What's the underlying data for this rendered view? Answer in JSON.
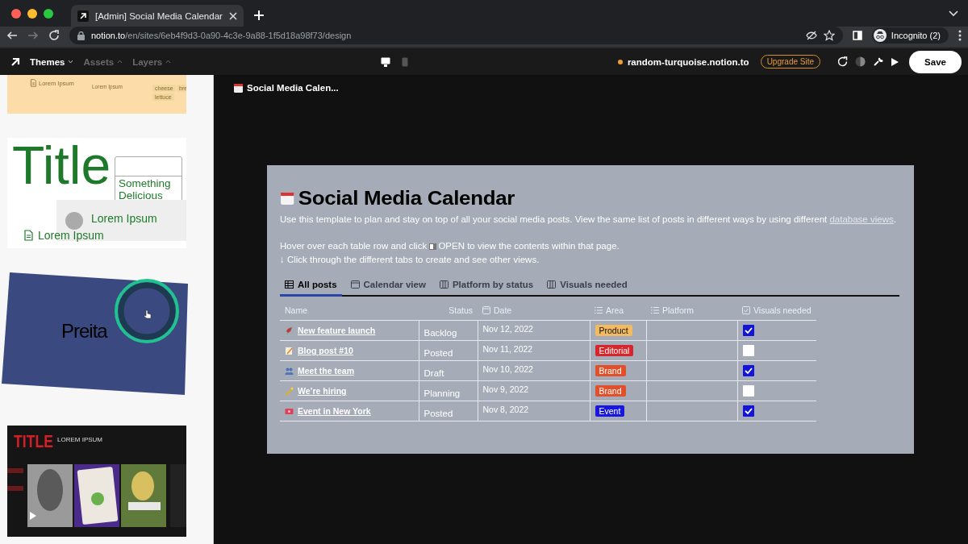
{
  "browser": {
    "tab_title": "[Admin] Social Media Calendar",
    "url_host": "notion.to",
    "url_path": "/en/sites/6eb4f9d3-0a90-4c3e-9a88-1f5d18a98f73/design",
    "profile_label": "Incognito (2)"
  },
  "toolbar": {
    "menus": [
      {
        "label": "Themes",
        "selected": true
      },
      {
        "label": "Assets",
        "selected": false
      },
      {
        "label": "Layers",
        "selected": false
      }
    ],
    "site_name": "random-turquoise.notion.to",
    "upgrade_button": "Upgrade Site",
    "save_button": "Save"
  },
  "sidebar": {
    "thumbnails": [
      {
        "kind": "table",
        "texts": [
          "Lorem Ipsum",
          "Lorem Ipsum"
        ],
        "tags": [
          "cheese",
          "bre",
          "lettuce"
        ]
      },
      {
        "kind": "title",
        "title": "Title",
        "box_text": "Something Delicious",
        "texts": [
          "Lorem Ipsum",
          "Lorem Ipsum"
        ]
      },
      {
        "kind": "dark",
        "texts": [
          "Preita"
        ]
      },
      {
        "kind": "posters",
        "title": "TITLE",
        "subtitle": "LOREM IPSUM"
      }
    ]
  },
  "page": {
    "breadcrumb": "Social Media Calen...",
    "title": "Social Media Calendar",
    "description": "Use this template to plan and stay on top of all your social media posts. View the same list of posts in different ways by using different ",
    "description_link": "database views",
    "description_end": ".",
    "instructions": [
      "Hover over each table row and click",
      "OPEN to view the contents within that page.",
      "↓ Click through the different tabs to create and see other views."
    ],
    "tabs": [
      {
        "label": "All posts",
        "selected": true
      },
      {
        "label": "Calendar view",
        "selected": false
      },
      {
        "label": "Platform by status",
        "selected": false
      },
      {
        "label": "Visuals needed",
        "selected": false
      }
    ],
    "columns": [
      "Name",
      "Status",
      "Date",
      "Area",
      "Platform",
      "Visuals needed"
    ],
    "rows": [
      {
        "name": "New feature launch",
        "status": "Backlog",
        "date": "Nov 12, 2022",
        "area": "Product",
        "color": "#f2bb62",
        "visuals_needed": true
      },
      {
        "name": "Blog post #10",
        "status": "Posted",
        "date": "Nov 11, 2022",
        "area": "Editorial",
        "color": "#d7262b",
        "visuals_needed": false
      },
      {
        "name": "Meet the team",
        "status": "Draft",
        "date": "Nov 10, 2022",
        "area": "Brand",
        "color": "#e0502a",
        "visuals_needed": true
      },
      {
        "name": "We’re hiring",
        "status": "Planning",
        "date": "Nov 9, 2022",
        "area": "Brand",
        "color": "#e0502a",
        "visuals_needed": false
      },
      {
        "name": "Event in New York",
        "status": "Posted",
        "date": "Nov 8, 2022",
        "area": "Event",
        "color": "#1717e0",
        "visuals_needed": true
      }
    ]
  }
}
